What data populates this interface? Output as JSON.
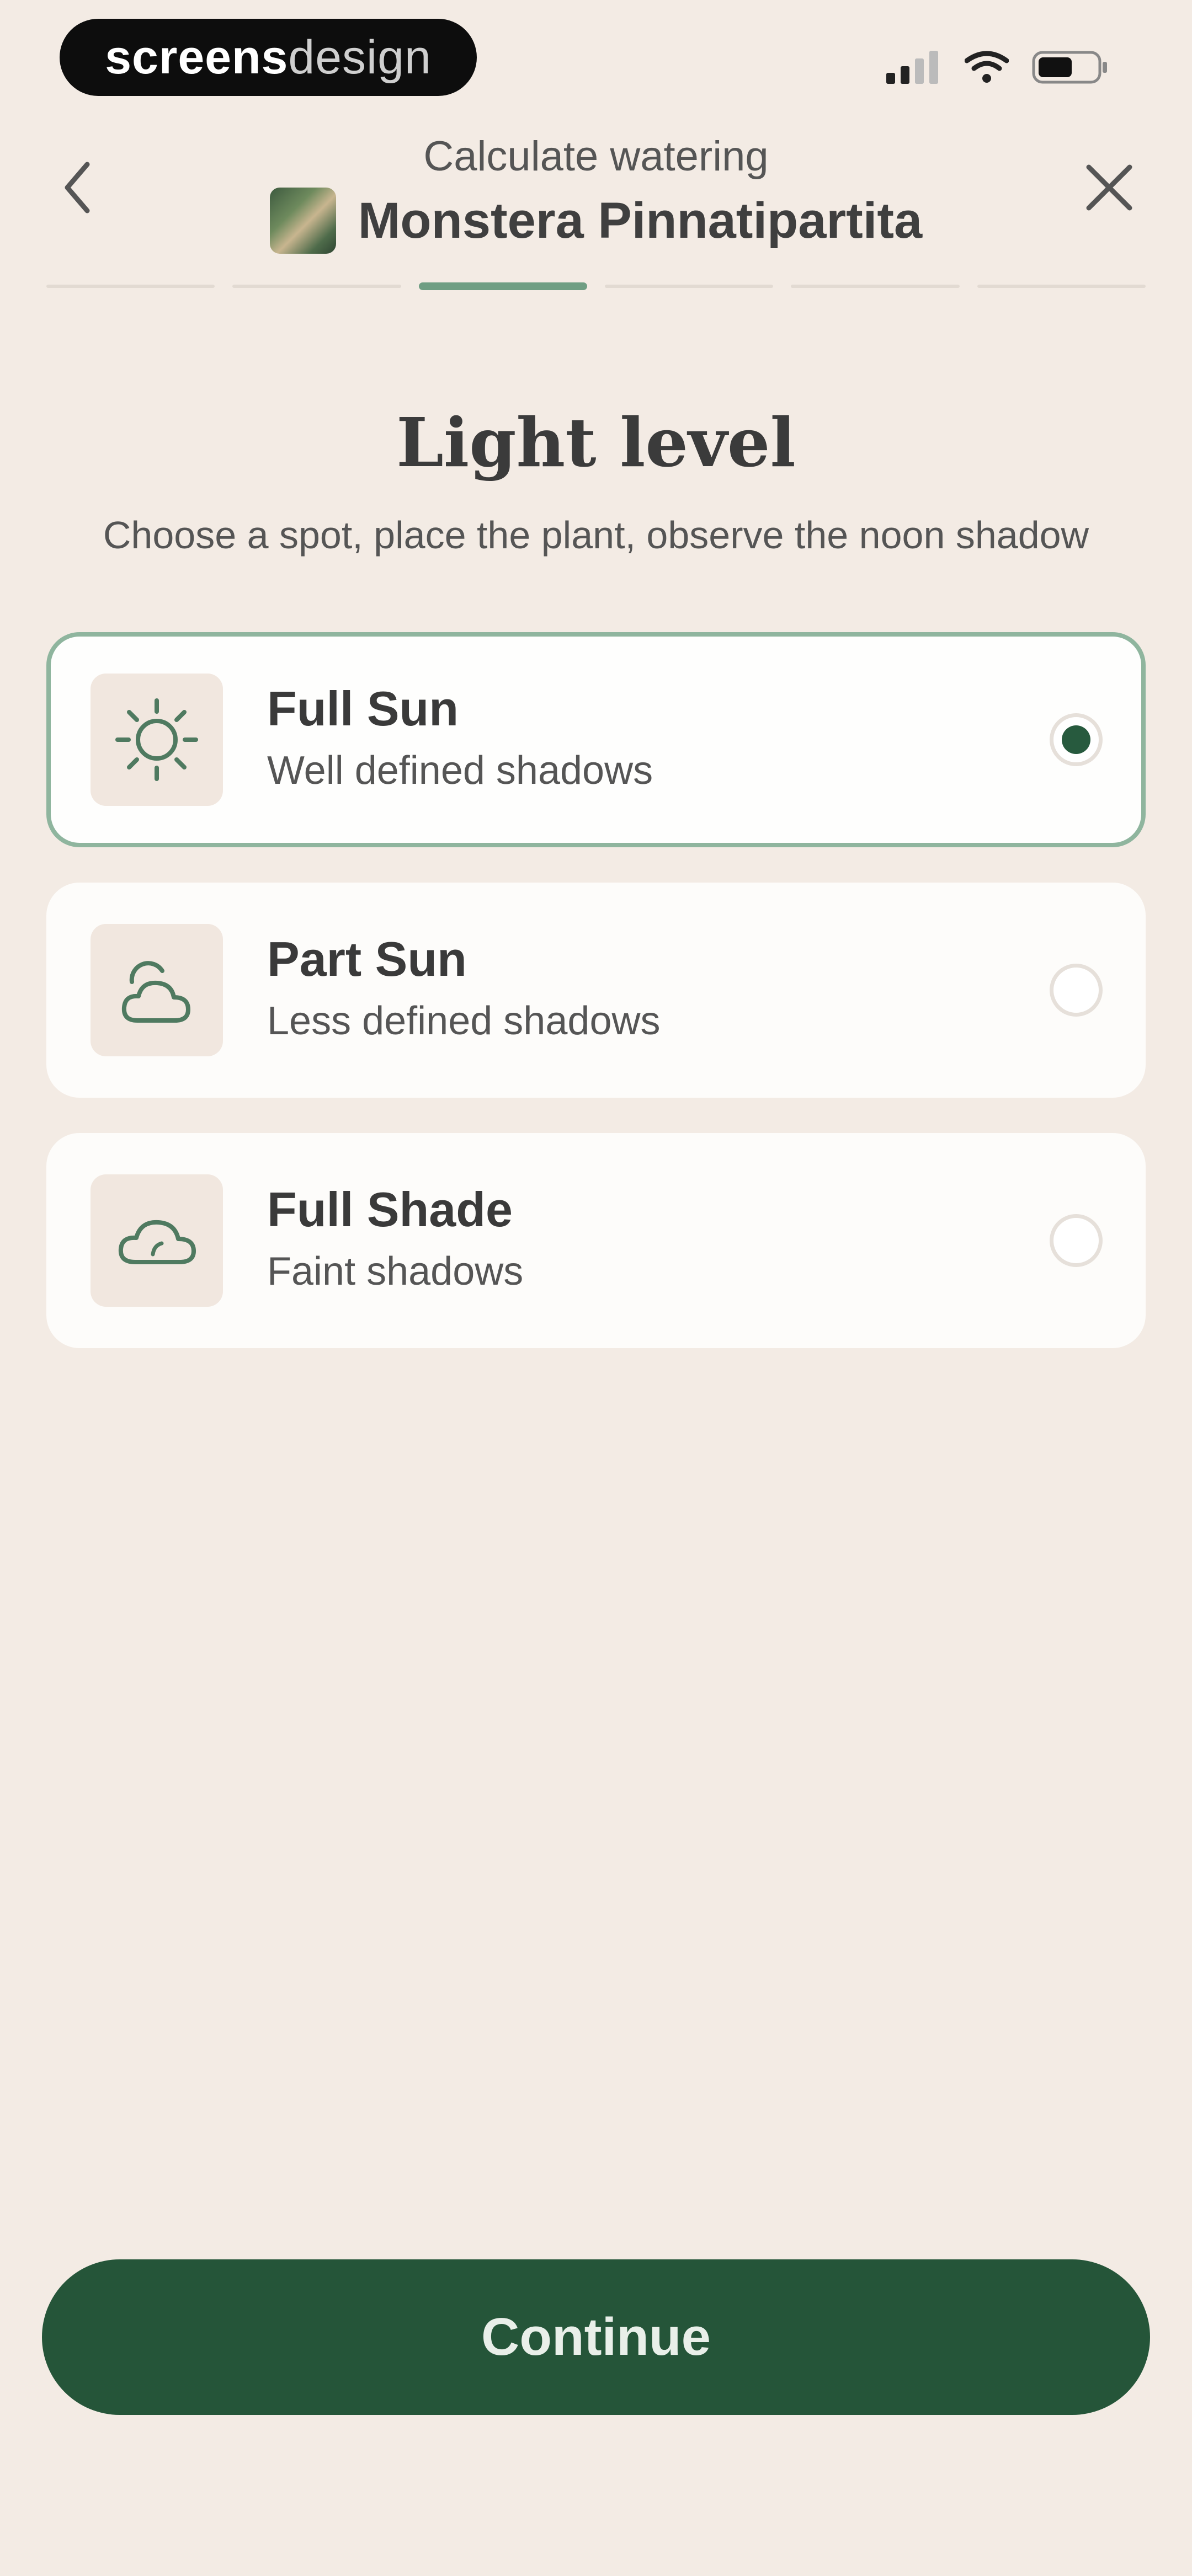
{
  "status_bar": {
    "brand_bold": "screens",
    "brand_light": "design",
    "icons": [
      "signal-icon",
      "wifi-icon",
      "battery-icon"
    ]
  },
  "header": {
    "subtitle": "Calculate watering",
    "plant_name": "Monstera Pinnatipartita",
    "back_icon": "chevron-left-icon",
    "close_icon": "close-icon"
  },
  "progress": {
    "total_steps": 6,
    "current_step": 3
  },
  "section": {
    "title": "Light level",
    "subtitle": "Choose a spot, place the plant, observe the noon shadow"
  },
  "options": [
    {
      "icon": "sun-icon",
      "title": "Full Sun",
      "description": "Well defined shadows",
      "selected": true
    },
    {
      "icon": "part-sun-icon",
      "title": "Part Sun",
      "description": "Less defined shadows",
      "selected": false
    },
    {
      "icon": "cloud-icon",
      "title": "Full Shade",
      "description": "Faint shadows",
      "selected": false
    }
  ],
  "footer": {
    "continue_label": "Continue"
  },
  "colors": {
    "background": "#f3ebe4",
    "accent": "#255539",
    "selected_border": "#8fb59e",
    "icon_stroke": "#4f7a60"
  }
}
